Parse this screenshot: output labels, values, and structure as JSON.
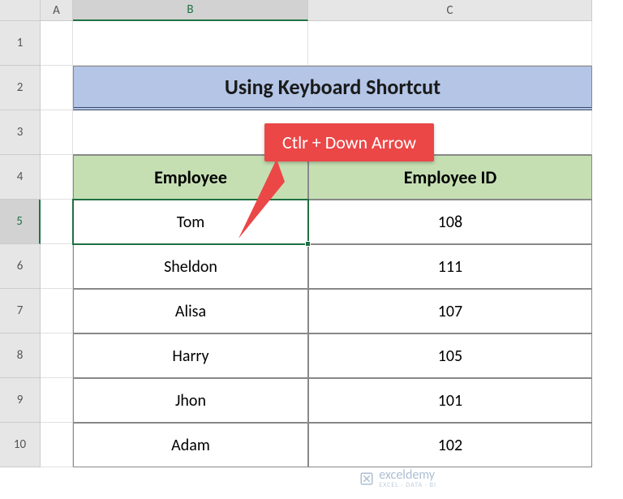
{
  "columns": [
    "",
    "A",
    "B",
    "C"
  ],
  "rows": [
    "1",
    "2",
    "3",
    "4",
    "5",
    "6",
    "7",
    "8",
    "9",
    "10"
  ],
  "selected": {
    "col": "B",
    "row": "5"
  },
  "title": "Using Keyboard Shortcut",
  "callout": "Ctlr + Down Arrow",
  "headers": {
    "employee": "Employee",
    "id": "Employee ID"
  },
  "data": [
    {
      "employee": "Tom",
      "id": "108"
    },
    {
      "employee": "Sheldon",
      "id": "111"
    },
    {
      "employee": "Alisa",
      "id": "107"
    },
    {
      "employee": "Harry",
      "id": "105"
    },
    {
      "employee": "Jhon",
      "id": "101"
    },
    {
      "employee": "Adam",
      "id": "102"
    }
  ],
  "watermark": {
    "name": "exceldemy",
    "tagline": "EXCEL · DATA · BI"
  },
  "chart_data": {
    "type": "table",
    "title": "Using Keyboard Shortcut",
    "columns": [
      "Employee",
      "Employee ID"
    ],
    "rows": [
      [
        "Tom",
        108
      ],
      [
        "Sheldon",
        111
      ],
      [
        "Alisa",
        107
      ],
      [
        "Harry",
        105
      ],
      [
        "Jhon",
        101
      ],
      [
        "Adam",
        102
      ]
    ]
  }
}
